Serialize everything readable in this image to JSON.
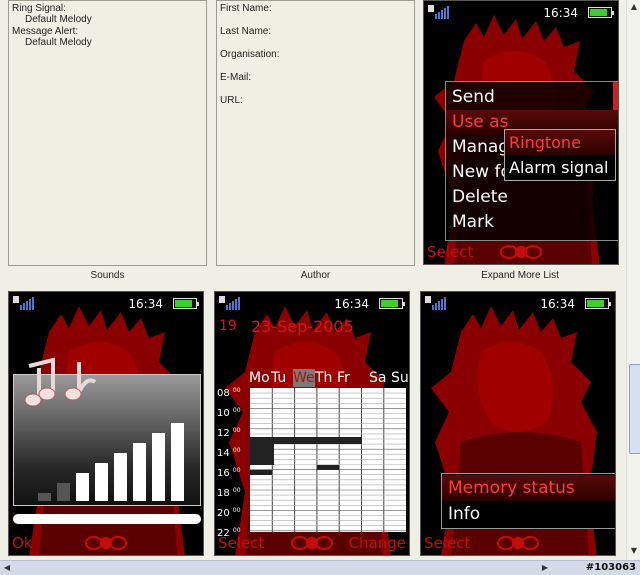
{
  "sounds_info": {
    "ring_signal_label": "Ring Signal:",
    "ring_signal_value": "Default Melody",
    "message_alert_label": "Message Alert:",
    "message_alert_value": "Default Melody",
    "caption": "Sounds"
  },
  "author_info": {
    "first_name_label": "First Name:",
    "last_name_label": "Last Name:",
    "organisation_label": "Organisation:",
    "email_label": "E-Mail:",
    "url_label": "URL:",
    "caption": "Author"
  },
  "expand_caption": "Expand More List",
  "status": {
    "time": "16:34",
    "battery_level": 0.85
  },
  "colors": {
    "accent": "#d71414",
    "background": "#000000",
    "battery": "#3ecf2e"
  },
  "screen_menu": {
    "items": [
      "Send",
      "Use as",
      "Manage",
      "New folder",
      "Delete",
      "Mark"
    ],
    "selected_index": 1,
    "submenu": [
      "Ringtone",
      "Alarm signal"
    ],
    "submenu_selected_index": 0,
    "left_softkey": "Select"
  },
  "screen_sounds": {
    "left_softkey": "Ok",
    "volume_level": 6,
    "volume_steps": 8,
    "icon": "music-notes-icon"
  },
  "screen_calendar": {
    "day_number": "19",
    "date": "23-Sep-2005",
    "weekdays": [
      "Mo",
      "Tu",
      "We",
      "Th",
      "Fr",
      "Sa",
      "Su"
    ],
    "today_index": 2,
    "hours": [
      "08",
      "10",
      "12",
      "14",
      "16",
      "18",
      "20",
      "22"
    ],
    "minutes": "00",
    "left_softkey": "Select",
    "right_softkey": "Change"
  },
  "screen_memory": {
    "items": [
      "Memory status",
      "Info"
    ],
    "selected_index": 0,
    "left_softkey": "Select"
  },
  "watermark": "#103063"
}
